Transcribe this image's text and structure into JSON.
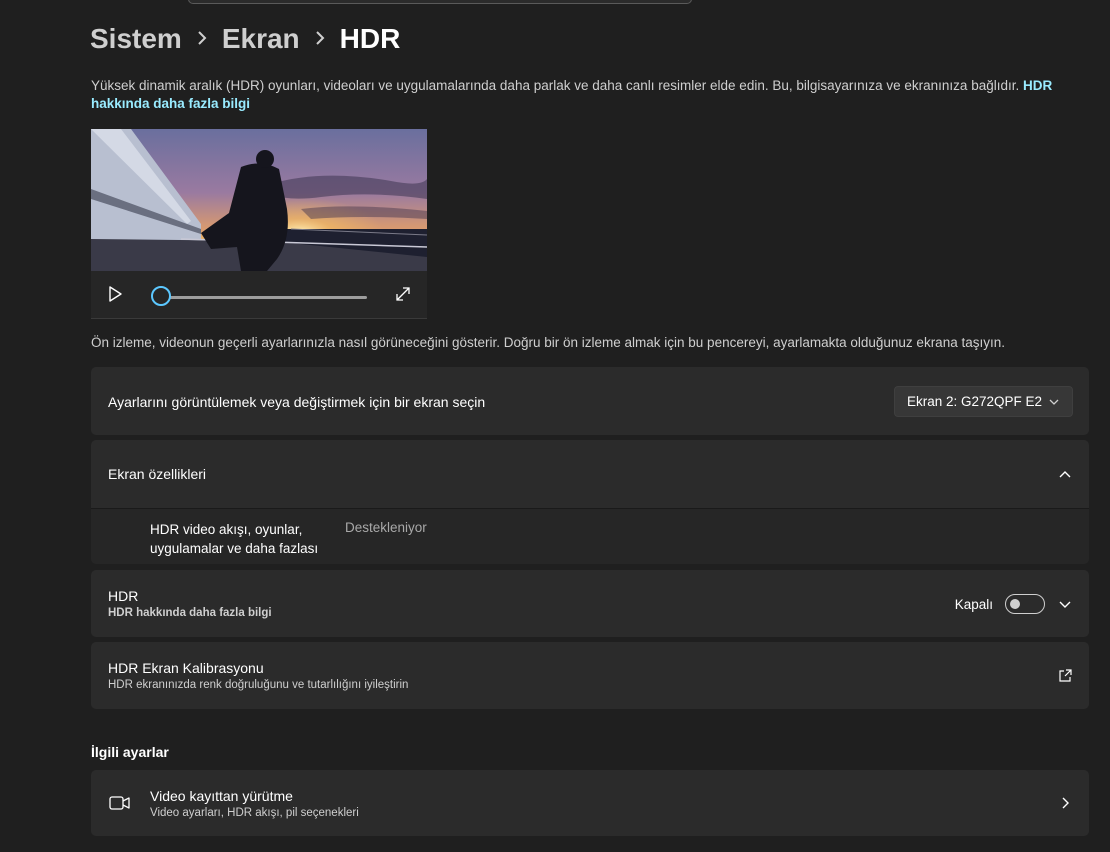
{
  "breadcrumb": {
    "items": [
      "Sistem",
      "Ekran"
    ],
    "current": "HDR"
  },
  "intro": {
    "text": "Yüksek dinamik aralık (HDR) oyunları, videoları ve uygulamalarında daha parlak ve daha canlı resimler elde edin. Bu, bilgisayarınıza ve ekranınıza bağlıdır.",
    "link": "HDR hakkında daha fazla bilgi"
  },
  "video": {
    "progress": 0.0
  },
  "preview_note": "Ön izleme, videonun geçerli ayarlarınızla nasıl görüneceğini gösterir. Doğru bir ön izleme almak için bu pencereyi, ayarlamakta olduğunuz ekrana taşıyın.",
  "display_select": {
    "label": "Ayarlarını görüntülemek veya değiştirmek için bir ekran seçin",
    "selected": "Ekran 2: G272QPF E2"
  },
  "display_properties": {
    "title": "Ekran özellikleri",
    "items": [
      {
        "label": "HDR video akışı, oyunlar, uygulamalar ve daha fazlası",
        "value": "Destekleniyor"
      }
    ]
  },
  "hdr": {
    "title": "HDR",
    "link": "HDR hakkında daha fazla bilgi",
    "toggle_label": "Kapalı",
    "enabled": false
  },
  "calibration": {
    "title": "HDR Ekran Kalibrasyonu",
    "subtitle": "HDR ekranınızda renk doğruluğunu ve tutarlılığını iyileştirin"
  },
  "related": {
    "heading": "İlgili ayarlar",
    "items": [
      {
        "title": "Video kayıttan yürütme",
        "subtitle": "Video ayarları, HDR akışı, pil seçenekleri",
        "icon": "video-camera-icon"
      }
    ]
  },
  "colors": {
    "accent": "#5cc8ff",
    "link": "#99ebff",
    "background": "#1f1f1f",
    "card": "#2b2b2b"
  }
}
